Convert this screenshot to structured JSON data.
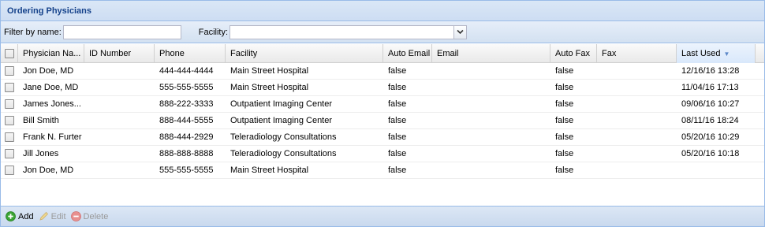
{
  "panel": {
    "title": "Ordering Physicians"
  },
  "filter": {
    "name_label": "Filter by name:",
    "name_value": "",
    "facility_label": "Facility:",
    "facility_value": ""
  },
  "grid": {
    "columns": [
      "Physician Na...",
      "ID Number",
      "Phone",
      "Facility",
      "Auto Email",
      "Email",
      "Auto Fax",
      "Fax",
      "Last Used"
    ],
    "sorted_column": "Last Used",
    "rows": [
      [
        "Jon Doe, MD",
        "",
        "444-444-4444",
        "Main Street Hospital",
        "false",
        "",
        "false",
        "",
        "12/16/16 13:28"
      ],
      [
        "Jane Doe, MD",
        "",
        "555-555-5555",
        "Main Street Hospital",
        "false",
        "",
        "false",
        "",
        "11/04/16 17:13"
      ],
      [
        "James Jones...",
        "",
        "888-222-3333",
        "Outpatient Imaging Center",
        "false",
        "",
        "false",
        "",
        "09/06/16 10:27"
      ],
      [
        "Bill Smith",
        "",
        "888-444-5555",
        "Outpatient Imaging Center",
        "false",
        "",
        "false",
        "",
        "08/11/16 18:24"
      ],
      [
        "Frank N. Furter",
        "",
        "888-444-2929",
        "Teleradiology Consultations",
        "false",
        "",
        "false",
        "",
        "05/20/16 10:29"
      ],
      [
        "Jill Jones",
        "",
        "888-888-8888",
        "Teleradiology Consultations",
        "false",
        "",
        "false",
        "",
        "05/20/16 10:18"
      ],
      [
        "Jon Doe, MD",
        "",
        "555-555-5555",
        "Main Street Hospital",
        "false",
        "",
        "false",
        "",
        ""
      ]
    ]
  },
  "toolbar": {
    "add_label": "Add",
    "edit_label": "Edit",
    "delete_label": "Delete"
  },
  "colors": {
    "header_text": "#15428b",
    "border": "#99bbe8",
    "add_icon": "#3aa434",
    "delete_icon": "#e07070"
  }
}
